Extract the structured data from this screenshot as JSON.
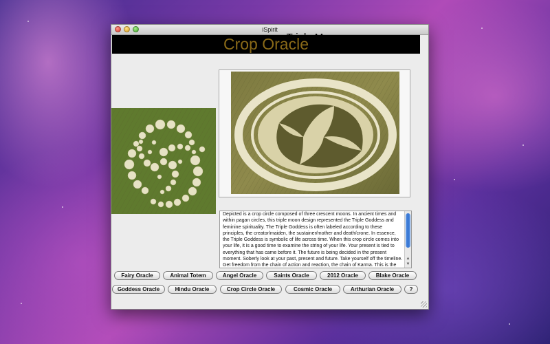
{
  "window": {
    "title": "iSpirit"
  },
  "banner": {
    "title": "Crop Oracle"
  },
  "card": {
    "title": "Triple Moon",
    "description": "Depicted is a crop circle composed of three crescent moons. In ancient times and within pagan circles, this triple moon design represented the Triple Goddess and feminine spirituality. The Triple Goddess is often labeled according to these principles, the creator/maiden, the sustainer/mother and death/crone. In essence, the Triple Goddess is symbolic of life across time. When this crop circle comes into your life, it is a good time to examine the string of your life. Your present is tied to everything that has came before it. The future is being decided in the present moment. Soberly look at your past, present and future. Take yourself off the timeline. Get freedom from the chain of action and reaction, the chain of Karma. This is the ability to make truly free"
  },
  "oracle_buttons": {
    "row1": [
      "Fairy Oracle",
      "Animal Totem",
      "Angel Oracle",
      "Saints Oracle",
      "2012 Oracle",
      "Blake Oracle"
    ],
    "row2": [
      "Goddess Oracle",
      "Hindu Oracle",
      "Crop Circle Oracle",
      "Cosmic Oracle",
      "Arthurian Oracle",
      "?"
    ]
  },
  "colors": {
    "banner_bg": "#000000",
    "banner_text": "#8a6a18",
    "scroll_thumb": "#2f6fd0"
  },
  "icons": {
    "scroll_up": "scroll-up-arrow-icon",
    "scroll_down": "scroll-down-arrow-icon"
  }
}
